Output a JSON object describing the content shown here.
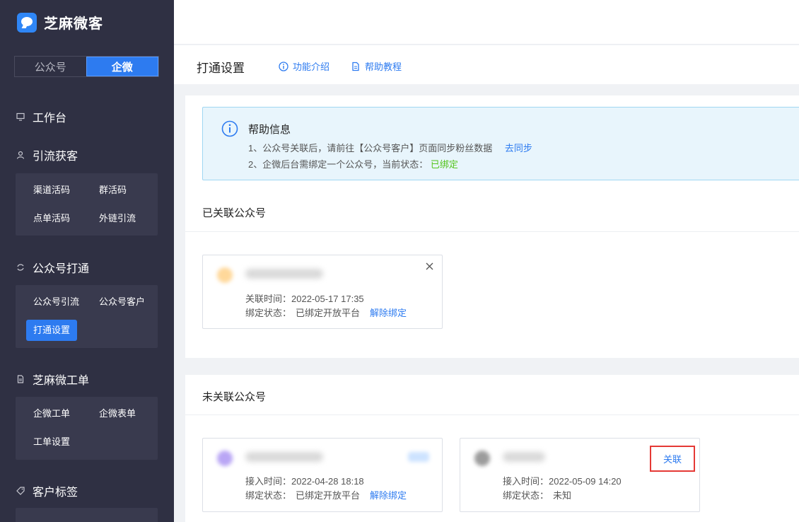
{
  "app": {
    "name": "芝麻微客"
  },
  "switch": {
    "left": "公众号",
    "right": "企微"
  },
  "nav": {
    "workbench": "工作台",
    "lead": {
      "label": "引流获客",
      "items": [
        "渠道活码",
        "群活码",
        "点单活码",
        "外链引流"
      ]
    },
    "oa": {
      "label": "公众号打通",
      "items": [
        "公众号引流",
        "公众号客户",
        "打通设置"
      ]
    },
    "ticket": {
      "label": "芝麻微工单",
      "items": [
        "企微工单",
        "企微表单",
        "工单设置"
      ]
    },
    "tags": {
      "label": "客户标签"
    }
  },
  "header": {
    "title": "打通设置",
    "intro": "功能介绍",
    "help": "帮助教程"
  },
  "alert": {
    "title": "帮助信息",
    "line1": "1、公众号关联后，请前往【公众号客户】页面同步粉丝数据",
    "line1_link": "去同步",
    "line2": "2、企微后台需绑定一个公众号，当前状态：",
    "line2_status": "已绑定"
  },
  "linked": {
    "title": "已关联公众号",
    "account": {
      "time_label": "关联时间：",
      "time": "2022-05-17 17:35",
      "status_label": "绑定状态：",
      "status": "已绑定开放平台",
      "unbind": "解除绑定"
    }
  },
  "unlinked": {
    "title": "未关联公众号",
    "accounts": [
      {
        "time_label": "接入时间：",
        "time": "2022-04-28 18:18",
        "status_label": "绑定状态：",
        "status": "已绑定开放平台",
        "unbind": "解除绑定"
      },
      {
        "time_label": "接入时间：",
        "time": "2022-05-09 14:20",
        "status_label": "绑定状态：",
        "status": "未知",
        "action": "关联"
      }
    ]
  },
  "icons": {
    "close": "close-icon",
    "info": "info-icon",
    "doc": "doc-icon"
  },
  "colors": {
    "accent": "#2d7bf0",
    "sidebar": "#2f3043",
    "success": "#52c41a",
    "highlight": "#e53935"
  }
}
